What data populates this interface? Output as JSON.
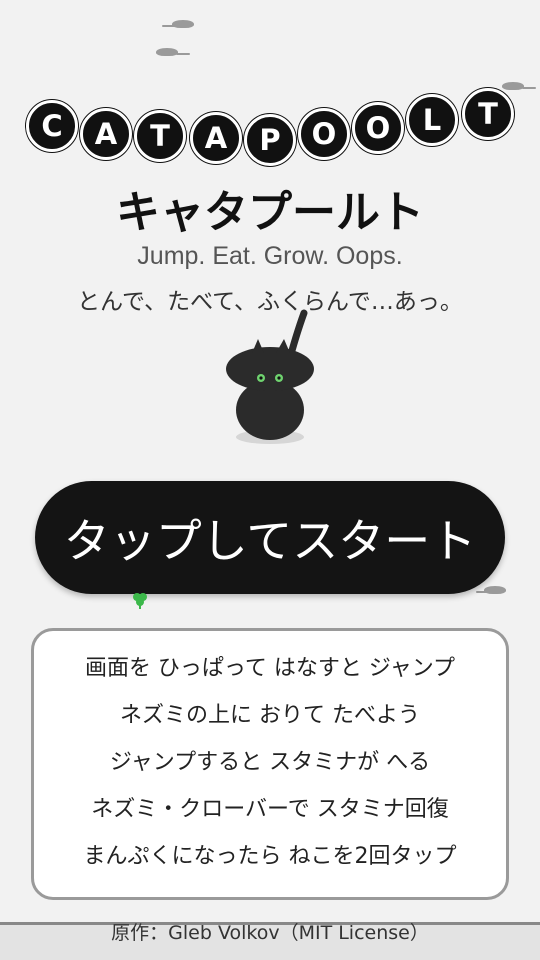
{
  "logo": {
    "letters": [
      "C",
      "A",
      "T",
      "A",
      "P",
      "O",
      "O",
      "L",
      "T"
    ]
  },
  "title_jp": "キャタプールト",
  "tagline_en": "Jump. Eat. Grow. Oops.",
  "tagline_jp": "とんで、たべて、ふくらんで…あっ。",
  "start_button": "タップしてスタート",
  "instructions": [
    "画面を ひっぱって はなすと ジャンプ",
    "ネズミの上に おりて たべよう",
    "ジャンプすると スタミナが へる",
    "ネズミ・クローバーで スタミナ回復",
    "まんぷくになったら ねこを2回タップ"
  ],
  "credit": "原作：Gleb Volkov（MIT License）",
  "colors": {
    "background": "#f2f2f2",
    "ball": "#111111",
    "button": "#141414",
    "cat_eyes": "#6fd36f",
    "clover": "#3cb84a"
  }
}
